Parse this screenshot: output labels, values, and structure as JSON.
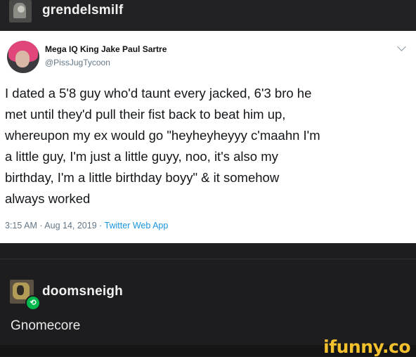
{
  "post": {
    "author": "grendelsmilf"
  },
  "tweet": {
    "display_name": "Mega IQ King Jake Paul Sartre",
    "handle": "@PissJugTycoon",
    "text": "I dated a 5'8 guy who'd taunt every jacked, 6'3 bro he\nmet until they'd pull their fist back to beat him up,\nwhereupon my ex would go \"heyheyheyyy c'maahn I'm\na little guy, I'm just a little guyy, noo, it's also my\nbirthday, I'm a little birthday boyy\" & it somehow\nalways worked",
    "timestamp": "3:15 AM · Aug 14, 2019 · ",
    "source_app": "Twitter Web App"
  },
  "reblog": {
    "author": "doomsneigh",
    "text": "Gnomecore",
    "badge_glyph": "⟲"
  },
  "watermark": {
    "text": "ifunny.co"
  },
  "colors": {
    "background": "#1d1d1f",
    "tweet_card": "#ffffff",
    "link_blue": "#1b95e0",
    "reblog_green": "#00b84c",
    "watermark_yellow": "#f2c02c"
  }
}
